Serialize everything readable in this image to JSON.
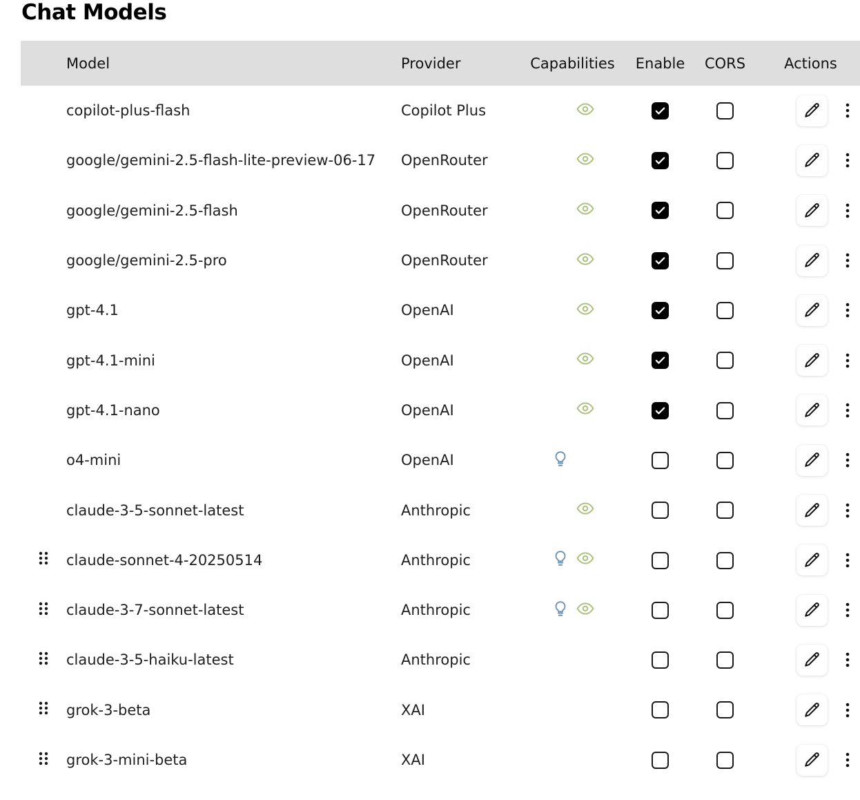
{
  "title": "Chat Models",
  "columns": {
    "model": "Model",
    "provider": "Provider",
    "capabilities": "Capabilities",
    "enable": "Enable",
    "cors": "CORS",
    "actions": "Actions"
  },
  "colors": {
    "vision_icon": "#a9c07a",
    "reasoning_icon": "#6b93b3",
    "header_bg": "#dedede"
  },
  "rows": [
    {
      "model": "copilot-plus-flash",
      "provider": "Copilot Plus",
      "draggable": false,
      "reasoning": false,
      "vision": true,
      "enabled": true,
      "cors": false
    },
    {
      "model": "google/gemini-2.5-flash-lite-preview-06-17",
      "provider": "OpenRouter",
      "draggable": false,
      "reasoning": false,
      "vision": true,
      "enabled": true,
      "cors": false
    },
    {
      "model": "google/gemini-2.5-flash",
      "provider": "OpenRouter",
      "draggable": false,
      "reasoning": false,
      "vision": true,
      "enabled": true,
      "cors": false
    },
    {
      "model": "google/gemini-2.5-pro",
      "provider": "OpenRouter",
      "draggable": false,
      "reasoning": false,
      "vision": true,
      "enabled": true,
      "cors": false
    },
    {
      "model": "gpt-4.1",
      "provider": "OpenAI",
      "draggable": false,
      "reasoning": false,
      "vision": true,
      "enabled": true,
      "cors": false
    },
    {
      "model": "gpt-4.1-mini",
      "provider": "OpenAI",
      "draggable": false,
      "reasoning": false,
      "vision": true,
      "enabled": true,
      "cors": false
    },
    {
      "model": "gpt-4.1-nano",
      "provider": "OpenAI",
      "draggable": false,
      "reasoning": false,
      "vision": true,
      "enabled": true,
      "cors": false
    },
    {
      "model": "o4-mini",
      "provider": "OpenAI",
      "draggable": false,
      "reasoning": true,
      "vision": false,
      "enabled": false,
      "cors": false
    },
    {
      "model": "claude-3-5-sonnet-latest",
      "provider": "Anthropic",
      "draggable": false,
      "reasoning": false,
      "vision": true,
      "enabled": false,
      "cors": false
    },
    {
      "model": "claude-sonnet-4-20250514",
      "provider": "Anthropic",
      "draggable": true,
      "reasoning": true,
      "vision": true,
      "enabled": false,
      "cors": false
    },
    {
      "model": "claude-3-7-sonnet-latest",
      "provider": "Anthropic",
      "draggable": true,
      "reasoning": true,
      "vision": true,
      "enabled": false,
      "cors": false
    },
    {
      "model": "claude-3-5-haiku-latest",
      "provider": "Anthropic",
      "draggable": true,
      "reasoning": false,
      "vision": false,
      "enabled": false,
      "cors": false
    },
    {
      "model": "grok-3-beta",
      "provider": "XAI",
      "draggable": true,
      "reasoning": false,
      "vision": false,
      "enabled": false,
      "cors": false
    },
    {
      "model": "grok-3-mini-beta",
      "provider": "XAI",
      "draggable": true,
      "reasoning": false,
      "vision": false,
      "enabled": false,
      "cors": false
    }
  ]
}
